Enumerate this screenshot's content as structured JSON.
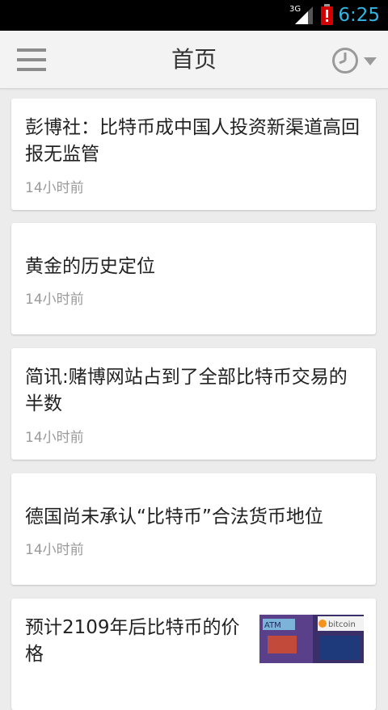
{
  "status_bar": {
    "network": "3G",
    "time": "6:25",
    "signal_icon": "signal-bars-icon",
    "battery_icon": "battery-low-icon",
    "accent_color": "#33b5e5",
    "battery_color": "#d20000"
  },
  "app_bar": {
    "title": "首页",
    "menu_icon": "hamburger-menu-icon",
    "clock_icon": "clock-icon",
    "dropdown_icon": "chevron-down-icon"
  },
  "articles": [
    {
      "title": "彭博社：比特币成中国人投资新渠道高回报无监管",
      "time": "14小时前"
    },
    {
      "title": "黄金的历史定位",
      "time": "14小时前"
    },
    {
      "title": "简讯:赌博网站占到了全部比特币交易的半数",
      "time": "14小时前"
    },
    {
      "title": "德国尚未承认“比特币”合法货币地位",
      "time": "14小时前"
    },
    {
      "title": "预计2109年后比特币的价格",
      "time": "",
      "thumbnail": {
        "left_text": "ATM",
        "right_text": "bitcoin"
      }
    }
  ]
}
